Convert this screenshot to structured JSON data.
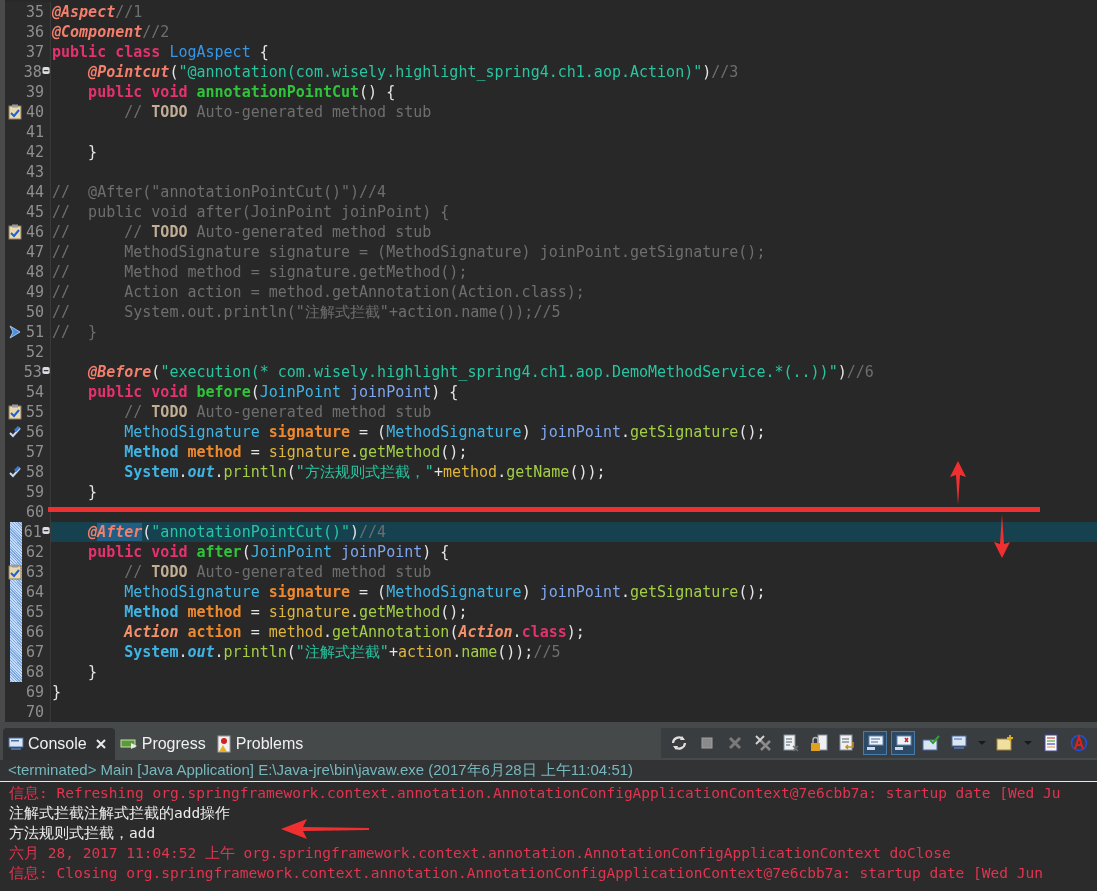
{
  "editor": {
    "lines": [
      {
        "number": "35",
        "fold": false,
        "current": false,
        "changed": false,
        "task": false,
        "occurrence": false,
        "bookmark": false,
        "tokens": [
          {
            "kind": "annotation",
            "text": "@Aspect"
          },
          {
            "kind": "comment",
            "text": "//1"
          }
        ]
      },
      {
        "number": "36",
        "fold": false,
        "current": false,
        "changed": false,
        "task": false,
        "occurrence": false,
        "bookmark": false,
        "tokens": [
          {
            "kind": "annotation",
            "text": "@Component"
          },
          {
            "kind": "comment",
            "text": "//2"
          }
        ]
      },
      {
        "number": "37",
        "fold": false,
        "current": false,
        "changed": false,
        "task": false,
        "occurrence": false,
        "bookmark": false,
        "tokens": [
          {
            "kind": "keyword",
            "text": "public "
          },
          {
            "kind": "keyword",
            "text": "class "
          },
          {
            "kind": "classdecl",
            "text": "LogAspect"
          },
          {
            "kind": "plain",
            "text": " {"
          }
        ]
      },
      {
        "number": "38",
        "fold": true,
        "current": false,
        "changed": false,
        "task": false,
        "occurrence": false,
        "bookmark": false,
        "tokens": [
          {
            "kind": "annotation",
            "text": "    @Pointcut"
          },
          {
            "kind": "plain",
            "text": "("
          },
          {
            "kind": "string",
            "text": "\"@annotation(com.wisely.highlight_spring4.ch1.aop.Action)\""
          },
          {
            "kind": "plain",
            "text": ")"
          },
          {
            "kind": "comment",
            "text": "//3"
          }
        ]
      },
      {
        "number": "39",
        "fold": false,
        "current": false,
        "changed": false,
        "task": false,
        "occurrence": false,
        "bookmark": false,
        "tokens": [
          {
            "kind": "keyword",
            "text": "    public "
          },
          {
            "kind": "keyword",
            "text": "void "
          },
          {
            "kind": "methoddecl",
            "text": "annotationPointCut"
          },
          {
            "kind": "plain",
            "text": "() {"
          }
        ]
      },
      {
        "number": "40",
        "fold": false,
        "current": false,
        "changed": false,
        "task": true,
        "occurrence": false,
        "bookmark": false,
        "tokens": [
          {
            "kind": "comment",
            "text": "        // "
          },
          {
            "kind": "todo",
            "text": "TODO"
          },
          {
            "kind": "comment",
            "text": " Auto-generated method stub"
          }
        ]
      },
      {
        "number": "41",
        "fold": false,
        "current": false,
        "changed": false,
        "task": false,
        "occurrence": false,
        "bookmark": false
      },
      {
        "number": "42",
        "fold": false,
        "current": false,
        "changed": false,
        "task": false,
        "occurrence": false,
        "bookmark": false,
        "tokens": [
          {
            "kind": "plain",
            "text": "    }"
          }
        ]
      },
      {
        "number": "43",
        "fold": false,
        "current": false,
        "changed": false,
        "task": false,
        "occurrence": false,
        "bookmark": false
      },
      {
        "number": "44",
        "fold": false,
        "current": false,
        "changed": false,
        "task": false,
        "occurrence": false,
        "bookmark": false,
        "tokens": [
          {
            "kind": "comment",
            "text": "//  @After(\"annotationPointCut()\")//4"
          }
        ]
      },
      {
        "number": "45",
        "fold": false,
        "current": false,
        "changed": false,
        "task": false,
        "occurrence": false,
        "bookmark": false,
        "tokens": [
          {
            "kind": "comment",
            "text": "//  public void after(JoinPoint joinPoint) {"
          }
        ]
      },
      {
        "number": "46",
        "fold": false,
        "current": false,
        "changed": false,
        "task": true,
        "occurrence": false,
        "bookmark": false,
        "tokens": [
          {
            "kind": "comment",
            "text": "//      // "
          },
          {
            "kind": "todo",
            "text": "TODO"
          },
          {
            "kind": "comment",
            "text": " Auto-generated method stub"
          }
        ]
      },
      {
        "number": "47",
        "fold": false,
        "current": false,
        "changed": false,
        "task": false,
        "occurrence": false,
        "bookmark": false,
        "tokens": [
          {
            "kind": "comment",
            "text": "//      MethodSignature signature = (MethodSignature) joinPoint.getSignature();"
          }
        ]
      },
      {
        "number": "48",
        "fold": false,
        "current": false,
        "changed": false,
        "task": false,
        "occurrence": false,
        "bookmark": false,
        "tokens": [
          {
            "kind": "comment",
            "text": "//      Method method = signature.getMethod();"
          }
        ]
      },
      {
        "number": "49",
        "fold": false,
        "current": false,
        "changed": false,
        "task": false,
        "occurrence": false,
        "bookmark": false,
        "tokens": [
          {
            "kind": "comment",
            "text": "//      Action action = method.getAnnotation(Action.class);"
          }
        ]
      },
      {
        "number": "50",
        "fold": false,
        "current": false,
        "changed": false,
        "task": false,
        "occurrence": false,
        "bookmark": false,
        "tokens": [
          {
            "kind": "comment",
            "text": "//      System.out.println(\"注解式拦截\"+action.name());//5"
          }
        ]
      },
      {
        "number": "51",
        "fold": false,
        "current": false,
        "changed": false,
        "task": false,
        "occurrence": false,
        "bookmark": true,
        "tokens": [
          {
            "kind": "comment",
            "text": "//  }"
          }
        ]
      },
      {
        "number": "52",
        "fold": false,
        "current": false,
        "changed": false,
        "task": false,
        "occurrence": false,
        "bookmark": false
      },
      {
        "number": "53",
        "fold": true,
        "current": false,
        "changed": false,
        "task": false,
        "occurrence": false,
        "bookmark": false,
        "tokens": [
          {
            "kind": "annotation",
            "text": "    @Before"
          },
          {
            "kind": "plain",
            "text": "("
          },
          {
            "kind": "string",
            "text": "\"execution(* com.wisely.highlight_spring4.ch1.aop.DemoMethodService.*(..))\""
          },
          {
            "kind": "plain",
            "text": ")"
          },
          {
            "kind": "comment",
            "text": "//6"
          }
        ]
      },
      {
        "number": "54",
        "fold": false,
        "current": false,
        "changed": false,
        "task": false,
        "occurrence": false,
        "bookmark": false,
        "tokens": [
          {
            "kind": "keyword",
            "text": "    public "
          },
          {
            "kind": "keyword",
            "text": "void "
          },
          {
            "kind": "methoddecl",
            "text": "before"
          },
          {
            "kind": "plain",
            "text": "("
          },
          {
            "kind": "interface",
            "text": "JoinPoint "
          },
          {
            "kind": "param",
            "text": "joinPoint"
          },
          {
            "kind": "plain",
            "text": ") {"
          }
        ]
      },
      {
        "number": "55",
        "fold": false,
        "current": false,
        "changed": false,
        "task": true,
        "occurrence": false,
        "bookmark": false,
        "tokens": [
          {
            "kind": "comment",
            "text": "        // "
          },
          {
            "kind": "todo",
            "text": "TODO"
          },
          {
            "kind": "comment",
            "text": " Auto-generated method stub"
          }
        ]
      },
      {
        "number": "56",
        "fold": false,
        "current": false,
        "changed": false,
        "task": false,
        "occurrence": true,
        "bookmark": false,
        "tokens": [
          {
            "kind": "interface",
            "text": "        MethodSignature "
          },
          {
            "kind": "local",
            "text": "signature"
          },
          {
            "kind": "plain",
            "text": " = ("
          },
          {
            "kind": "interface",
            "text": "MethodSignature"
          },
          {
            "kind": "plain",
            "text": ") "
          },
          {
            "kind": "param",
            "text": "joinPoint"
          },
          {
            "kind": "plain",
            "text": "."
          },
          {
            "kind": "call",
            "text": "getSignature"
          },
          {
            "kind": "plain",
            "text": "();"
          }
        ]
      },
      {
        "number": "57",
        "fold": false,
        "current": false,
        "changed": false,
        "task": false,
        "occurrence": false,
        "bookmark": false,
        "tokens": [
          {
            "kind": "class",
            "text": "        Method "
          },
          {
            "kind": "local",
            "text": "method"
          },
          {
            "kind": "plain",
            "text": " = "
          },
          {
            "kind": "localref",
            "text": "signature"
          },
          {
            "kind": "plain",
            "text": "."
          },
          {
            "kind": "call",
            "text": "getMethod"
          },
          {
            "kind": "plain",
            "text": "();"
          }
        ]
      },
      {
        "number": "58",
        "fold": false,
        "current": false,
        "changed": false,
        "task": false,
        "occurrence": true,
        "bookmark": false,
        "tokens": [
          {
            "kind": "class",
            "text": "        System"
          },
          {
            "kind": "plain",
            "text": "."
          },
          {
            "kind": "static",
            "text": "out"
          },
          {
            "kind": "plain",
            "text": "."
          },
          {
            "kind": "call",
            "text": "println"
          },
          {
            "kind": "plain",
            "text": "("
          },
          {
            "kind": "string",
            "text": "\"方法规则式拦截，\""
          },
          {
            "kind": "plain",
            "text": "+"
          },
          {
            "kind": "localref",
            "text": "method"
          },
          {
            "kind": "plain",
            "text": "."
          },
          {
            "kind": "call",
            "text": "getName"
          },
          {
            "kind": "plain",
            "text": "());"
          }
        ]
      },
      {
        "number": "59",
        "fold": false,
        "current": false,
        "changed": false,
        "task": false,
        "occurrence": false,
        "bookmark": false,
        "tokens": [
          {
            "kind": "plain",
            "text": "    }"
          }
        ]
      },
      {
        "number": "60",
        "fold": false,
        "current": false,
        "changed": false,
        "task": false,
        "occurrence": false,
        "bookmark": false
      },
      {
        "number": "61",
        "fold": true,
        "current": true,
        "changed": true,
        "task": false,
        "occurrence": false,
        "bookmark": false,
        "tokens": [
          {
            "kind": "annotation",
            "text": "    @"
          },
          {
            "kind": "annotation",
            "text": "After",
            "marked": true
          },
          {
            "kind": "plain",
            "text": "("
          },
          {
            "kind": "string",
            "text": "\"annotationPointCut()\""
          },
          {
            "kind": "plain",
            "text": ")"
          },
          {
            "kind": "comment",
            "text": "//4"
          }
        ]
      },
      {
        "number": "62",
        "fold": false,
        "current": false,
        "changed": true,
        "task": false,
        "occurrence": false,
        "bookmark": false,
        "tokens": [
          {
            "kind": "keyword",
            "text": "    public "
          },
          {
            "kind": "keyword",
            "text": "void "
          },
          {
            "kind": "methoddecl",
            "text": "after"
          },
          {
            "kind": "plain",
            "text": "("
          },
          {
            "kind": "interface",
            "text": "JoinPoint "
          },
          {
            "kind": "param",
            "text": "joinPoint"
          },
          {
            "kind": "plain",
            "text": ") {"
          }
        ]
      },
      {
        "number": "63",
        "fold": false,
        "current": false,
        "changed": true,
        "task": true,
        "occurrence": false,
        "bookmark": false,
        "tokens": [
          {
            "kind": "comment",
            "text": "        // "
          },
          {
            "kind": "todo",
            "text": "TODO"
          },
          {
            "kind": "comment",
            "text": " Auto-generated method stub"
          }
        ]
      },
      {
        "number": "64",
        "fold": false,
        "current": false,
        "changed": true,
        "task": false,
        "occurrence": false,
        "bookmark": false,
        "tokens": [
          {
            "kind": "interface",
            "text": "        MethodSignature "
          },
          {
            "kind": "local",
            "text": "signature"
          },
          {
            "kind": "plain",
            "text": " = ("
          },
          {
            "kind": "interface",
            "text": "MethodSignature"
          },
          {
            "kind": "plain",
            "text": ") "
          },
          {
            "kind": "param",
            "text": "joinPoint"
          },
          {
            "kind": "plain",
            "text": "."
          },
          {
            "kind": "call",
            "text": "getSignature"
          },
          {
            "kind": "plain",
            "text": "();"
          }
        ]
      },
      {
        "number": "65",
        "fold": false,
        "current": false,
        "changed": true,
        "task": false,
        "occurrence": false,
        "bookmark": false,
        "tokens": [
          {
            "kind": "class",
            "text": "        Method "
          },
          {
            "kind": "local",
            "text": "method"
          },
          {
            "kind": "plain",
            "text": " = "
          },
          {
            "kind": "localref",
            "text": "signature"
          },
          {
            "kind": "plain",
            "text": "."
          },
          {
            "kind": "call",
            "text": "getMethod"
          },
          {
            "kind": "plain",
            "text": "();"
          }
        ]
      },
      {
        "number": "66",
        "fold": false,
        "current": false,
        "changed": true,
        "task": false,
        "occurrence": false,
        "bookmark": false,
        "tokens": [
          {
            "kind": "annotype",
            "text": "        Action "
          },
          {
            "kind": "local",
            "text": "action"
          },
          {
            "kind": "plain",
            "text": " = "
          },
          {
            "kind": "localref",
            "text": "method"
          },
          {
            "kind": "plain",
            "text": "."
          },
          {
            "kind": "call",
            "text": "getAnnotation"
          },
          {
            "kind": "plain",
            "text": "("
          },
          {
            "kind": "annotype",
            "text": "Action"
          },
          {
            "kind": "plain",
            "text": "."
          },
          {
            "kind": "keyword",
            "text": "class"
          },
          {
            "kind": "plain",
            "text": ");"
          }
        ]
      },
      {
        "number": "67",
        "fold": false,
        "current": false,
        "changed": true,
        "task": false,
        "occurrence": false,
        "bookmark": false,
        "tokens": [
          {
            "kind": "class",
            "text": "        System"
          },
          {
            "kind": "plain",
            "text": "."
          },
          {
            "kind": "static",
            "text": "out"
          },
          {
            "kind": "plain",
            "text": "."
          },
          {
            "kind": "call",
            "text": "println"
          },
          {
            "kind": "plain",
            "text": "("
          },
          {
            "kind": "string",
            "text": "\"注解式拦截\""
          },
          {
            "kind": "plain",
            "text": "+"
          },
          {
            "kind": "localref",
            "text": "action"
          },
          {
            "kind": "plain",
            "text": "."
          },
          {
            "kind": "call",
            "text": "name"
          },
          {
            "kind": "plain",
            "text": "());"
          },
          {
            "kind": "comment",
            "text": "//5"
          }
        ]
      },
      {
        "number": "68",
        "fold": false,
        "current": false,
        "changed": true,
        "task": false,
        "occurrence": false,
        "bookmark": false,
        "tokens": [
          {
            "kind": "plain",
            "text": "    }"
          }
        ]
      },
      {
        "number": "69",
        "fold": false,
        "current": false,
        "changed": false,
        "task": false,
        "occurrence": false,
        "bookmark": false,
        "tokens": [
          {
            "kind": "plain",
            "text": "}"
          }
        ]
      },
      {
        "number": "70",
        "fold": false,
        "current": false,
        "changed": false,
        "task": false,
        "occurrence": false,
        "bookmark": false
      }
    ]
  },
  "panel": {
    "tabs": [
      {
        "label": "Console",
        "selected": true
      },
      {
        "label": "Progress",
        "selected": false
      },
      {
        "label": "Problems",
        "selected": false
      }
    ],
    "toolbar": [
      {
        "kind": "sync",
        "pressed": false
      },
      {
        "kind": "stop",
        "pressed": false
      },
      {
        "kind": "remove",
        "pressed": false
      },
      {
        "kind": "remove-all",
        "pressed": false
      },
      {
        "kind": "clear",
        "pressed": false
      },
      {
        "kind": "lock",
        "pressed": false
      },
      {
        "kind": "wrap",
        "pressed": false
      },
      {
        "kind": "show-out",
        "pressed": true
      },
      {
        "kind": "show-err",
        "pressed": true
      },
      {
        "kind": "pin",
        "pressed": false
      },
      {
        "kind": "display",
        "pressed": false
      },
      {
        "kind": "dropdown",
        "pressed": false
      },
      {
        "kind": "new",
        "pressed": false
      },
      {
        "kind": "dropdown",
        "pressed": false
      },
      {
        "kind": "list",
        "pressed": false
      },
      {
        "kind": "circle",
        "pressed": false
      }
    ],
    "header": "<terminated> Main [Java Application] E:\\Java-jre\\bin\\javaw.exe (2017年6月28日 上午11:04:51)",
    "lines": [
      {
        "kind": "info",
        "text": "信息: Refreshing org.springframework.context.annotation.AnnotationConfigApplicationContext@7e6cbb7a: startup date [Wed Ju"
      },
      {
        "kind": "output",
        "text": "注解式拦截注解式拦截的add操作"
      },
      {
        "kind": "output",
        "text": "方法规则式拦截，add"
      },
      {
        "kind": "info",
        "text": "六月 28, 2017 11:04:52 上午 org.springframework.context.annotation.AnnotationConfigApplicationContext doClose"
      },
      {
        "kind": "info",
        "text": "信息: Closing org.springframework.context.annotation.AnnotationConfigApplicationContext@7e6cbb7a: startup date [Wed Jun"
      }
    ]
  }
}
